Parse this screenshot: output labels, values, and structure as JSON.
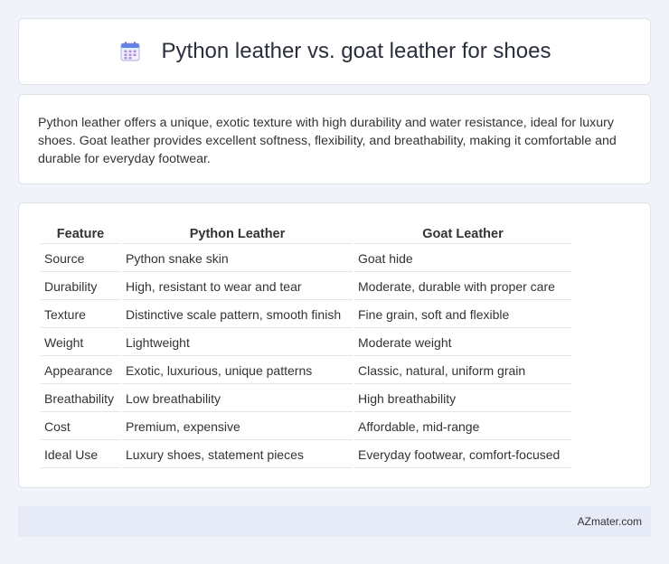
{
  "header": {
    "title": "Python leather vs. goat leather for shoes",
    "icon": "calendar-icon"
  },
  "summary": {
    "text": "Python leather offers a unique, exotic texture with high durability and water resistance, ideal for luxury shoes. Goat leather provides excellent softness, flexibility, and breathability, making it comfortable and durable for everyday footwear."
  },
  "table": {
    "headers": [
      "Feature",
      "Python Leather",
      "Goat Leather"
    ],
    "rows": [
      [
        "Source",
        "Python snake skin",
        "Goat hide"
      ],
      [
        "Durability",
        "High, resistant to wear and tear",
        "Moderate, durable with proper care"
      ],
      [
        "Texture",
        "Distinctive scale pattern, smooth finish",
        "Fine grain, soft and flexible"
      ],
      [
        "Weight",
        "Lightweight",
        "Moderate weight"
      ],
      [
        "Appearance",
        "Exotic, luxurious, unique patterns",
        "Classic, natural, uniform grain"
      ],
      [
        "Breathability",
        "Low breathability",
        "High breathability"
      ],
      [
        "Cost",
        "Premium, expensive",
        "Affordable, mid-range"
      ],
      [
        "Ideal Use",
        "Luxury shoes, statement pieces",
        "Everyday footwear, comfort-focused"
      ]
    ]
  },
  "footer": {
    "text": "AZmater.com"
  },
  "colors": {
    "background": "#f0f3f9",
    "card": "#ffffff",
    "footer_bar": "#e6ebf7",
    "icon_accent": "#7b8fe0"
  }
}
